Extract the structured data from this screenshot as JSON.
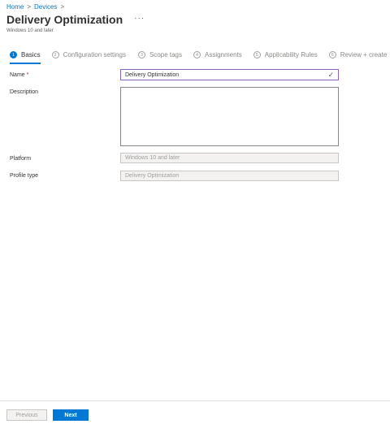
{
  "breadcrumb": {
    "items": [
      "Home",
      "Devices"
    ],
    "separator": ">"
  },
  "header": {
    "title": "Delivery Optimization",
    "more": "···",
    "subtitle": "Windows 10 and later"
  },
  "steps": [
    {
      "num": "1",
      "label": "Basics",
      "active": true
    },
    {
      "num": "2",
      "label": "Configuration settings",
      "active": false
    },
    {
      "num": "3",
      "label": "Scope tags",
      "active": false
    },
    {
      "num": "4",
      "label": "Assignments",
      "active": false
    },
    {
      "num": "5",
      "label": "Applicability Rules",
      "active": false
    },
    {
      "num": "6",
      "label": "Review + create",
      "active": false
    }
  ],
  "form": {
    "name_label": "Name",
    "required_mark": "*",
    "name_value": "Delivery Optimization",
    "description_label": "Description",
    "description_value": "",
    "platform_label": "Platform",
    "platform_value": "Windows 10 and later",
    "profile_type_label": "Profile type",
    "profile_type_value": "Delivery Optimization"
  },
  "footer": {
    "previous_label": "Previous",
    "next_label": "Next"
  },
  "colors": {
    "accent": "#0078d4",
    "required": "#a4262c",
    "focus_border": "#8764b8"
  },
  "icons": {
    "valid": "checkmark-icon"
  }
}
